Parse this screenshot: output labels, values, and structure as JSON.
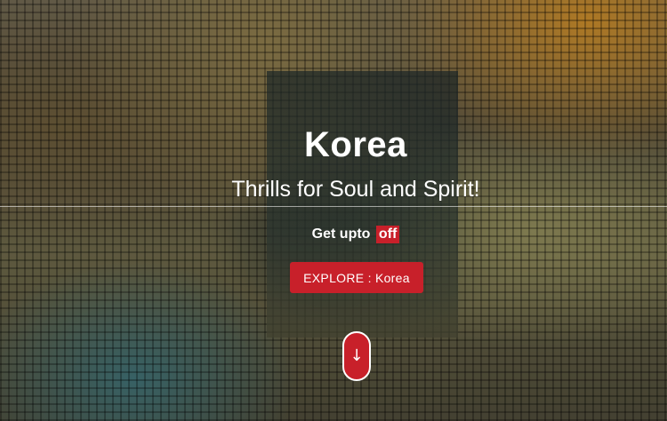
{
  "hero": {
    "title": "Korea",
    "subtitle": "Thrills for Soul and Spirit!",
    "offer_prefix": "Get upto",
    "offer_badge": "off",
    "explore_label": "EXPLORE : Korea",
    "scroll_icon": "arrow-down-icon",
    "scroll_glyph": "↓"
  },
  "colors": {
    "accent": "#c8202a",
    "text": "#ffffff"
  }
}
